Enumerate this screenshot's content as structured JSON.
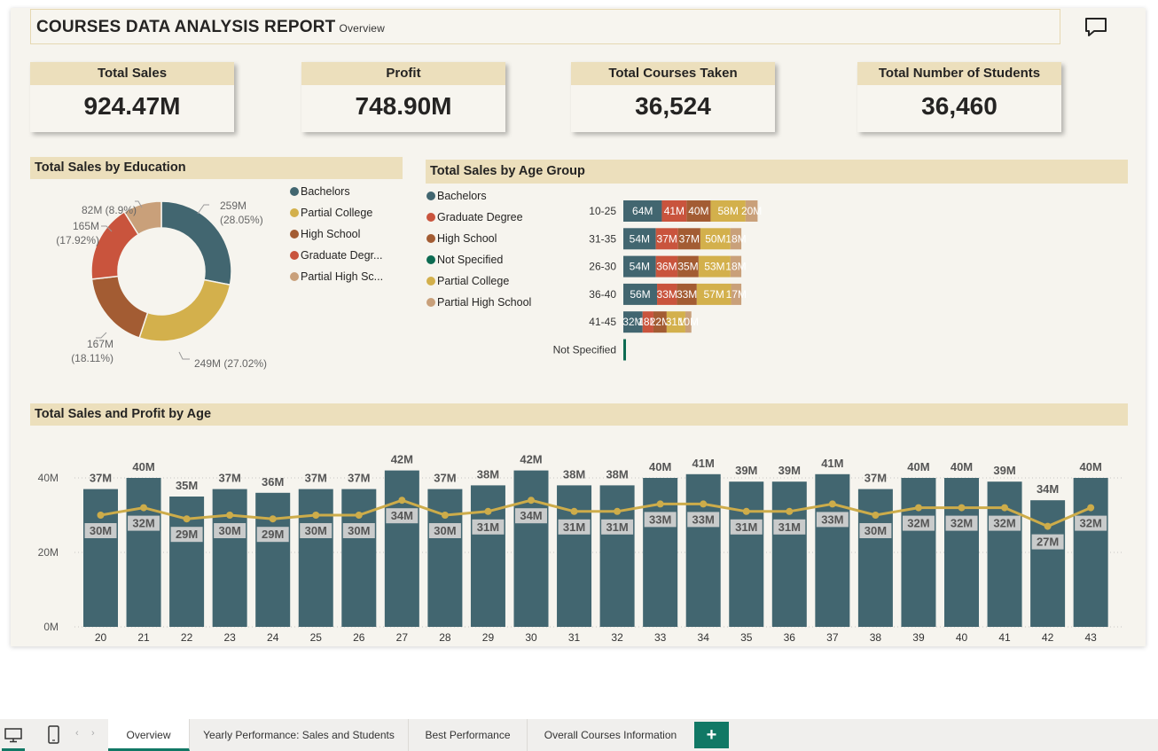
{
  "header": {
    "title": "COURSES DATA ANALYSIS REPORT",
    "subtitle": "Overview",
    "comment_icon": "comment-icon"
  },
  "kpis": [
    {
      "label": "Total Sales",
      "value": "924.47M"
    },
    {
      "label": "Profit",
      "value": "748.90M"
    },
    {
      "label": "Total Courses Taken",
      "value": "36,524"
    },
    {
      "label": "Total Number of Students",
      "value": "36,460"
    }
  ],
  "colors": {
    "bachelors": "#426670",
    "partial_college": "#d3b04c",
    "high_school": "#a35c33",
    "graduate_degree": "#c9543d",
    "partial_high_school": "#c9a07a",
    "not_specified": "#0d6b52",
    "line": "#cdac4a",
    "accent": "#117865"
  },
  "education_chart": {
    "title": "Total Sales by Education",
    "legend": [
      "Bachelors",
      "Partial College",
      "High School",
      "Graduate Degr...",
      "Partial High Sc..."
    ],
    "slice_labels": [
      {
        "value": "259M",
        "pct": "(28.05%)"
      },
      {
        "value": "249M (27.02%)",
        "pct": ""
      },
      {
        "value": "167M",
        "pct": "(18.11%)"
      },
      {
        "value": "165M",
        "pct": "(17.92%)"
      },
      {
        "value": "82M (8.9%)",
        "pct": ""
      }
    ]
  },
  "age_group_chart": {
    "title": "Total Sales by Age Group",
    "legend": [
      "Bachelors",
      "Graduate Degree",
      "High School",
      "Not Specified",
      "Partial College",
      "Partial High School"
    ]
  },
  "age_chart": {
    "title": "Total Sales and Profit by Age",
    "y_ticks": [
      "40M",
      "20M",
      "0M"
    ]
  },
  "chart_data": [
    {
      "type": "pie",
      "title": "Total Sales by Education",
      "categories": [
        "Bachelors",
        "Partial College",
        "High School",
        "Graduate Degree",
        "Partial High School"
      ],
      "values": [
        259,
        249,
        167,
        165,
        82
      ],
      "percent": [
        28.05,
        27.02,
        18.11,
        17.92,
        8.9
      ],
      "unit": "M",
      "legend": "right"
    },
    {
      "type": "bar",
      "title": "Total Sales by Age Group",
      "orientation": "horizontal",
      "stacked": true,
      "categories": [
        "10-25",
        "31-35",
        "26-30",
        "36-40",
        "41-45",
        "Not Specified"
      ],
      "series": [
        {
          "name": "Bachelors",
          "values": [
            64,
            54,
            54,
            56,
            32,
            null
          ]
        },
        {
          "name": "Graduate Degree",
          "values": [
            41,
            37,
            36,
            33,
            18,
            null
          ]
        },
        {
          "name": "High School",
          "values": [
            40,
            37,
            35,
            33,
            22,
            null
          ]
        },
        {
          "name": "Not Specified",
          "values": [
            null,
            null,
            null,
            null,
            null,
            0.5
          ]
        },
        {
          "name": "Partial College",
          "values": [
            58,
            50,
            53,
            57,
            31,
            null
          ]
        },
        {
          "name": "Partial High School",
          "values": [
            20,
            18,
            18,
            17,
            10,
            null
          ]
        }
      ],
      "unit": "M",
      "legend": "left"
    },
    {
      "type": "bar",
      "title": "Total Sales and Profit by Age",
      "categories": [
        "20",
        "21",
        "22",
        "23",
        "24",
        "25",
        "26",
        "27",
        "28",
        "29",
        "30",
        "31",
        "32",
        "33",
        "34",
        "35",
        "36",
        "37",
        "38",
        "39",
        "40",
        "41",
        "42",
        "43"
      ],
      "series": [
        {
          "name": "Total Sales",
          "kind": "bar",
          "values": [
            37,
            40,
            35,
            37,
            36,
            37,
            37,
            42,
            37,
            38,
            42,
            38,
            38,
            40,
            41,
            39,
            39,
            41,
            37,
            40,
            40,
            39,
            34,
            40
          ]
        },
        {
          "name": "Profit",
          "kind": "line",
          "values": [
            30,
            32,
            29,
            30,
            29,
            30,
            30,
            34,
            30,
            31,
            34,
            31,
            31,
            33,
            33,
            31,
            31,
            33,
            30,
            32,
            32,
            32,
            27,
            32
          ]
        }
      ],
      "unit": "M",
      "ylim": [
        0,
        42
      ],
      "y_ticks": [
        0,
        20,
        40
      ],
      "grid": true
    }
  ],
  "tabs": {
    "items": [
      "Overview",
      "Yearly Performance: Sales and Students",
      "Best Performance",
      "Overall Courses Information"
    ],
    "active": "Overview",
    "add": "+"
  }
}
